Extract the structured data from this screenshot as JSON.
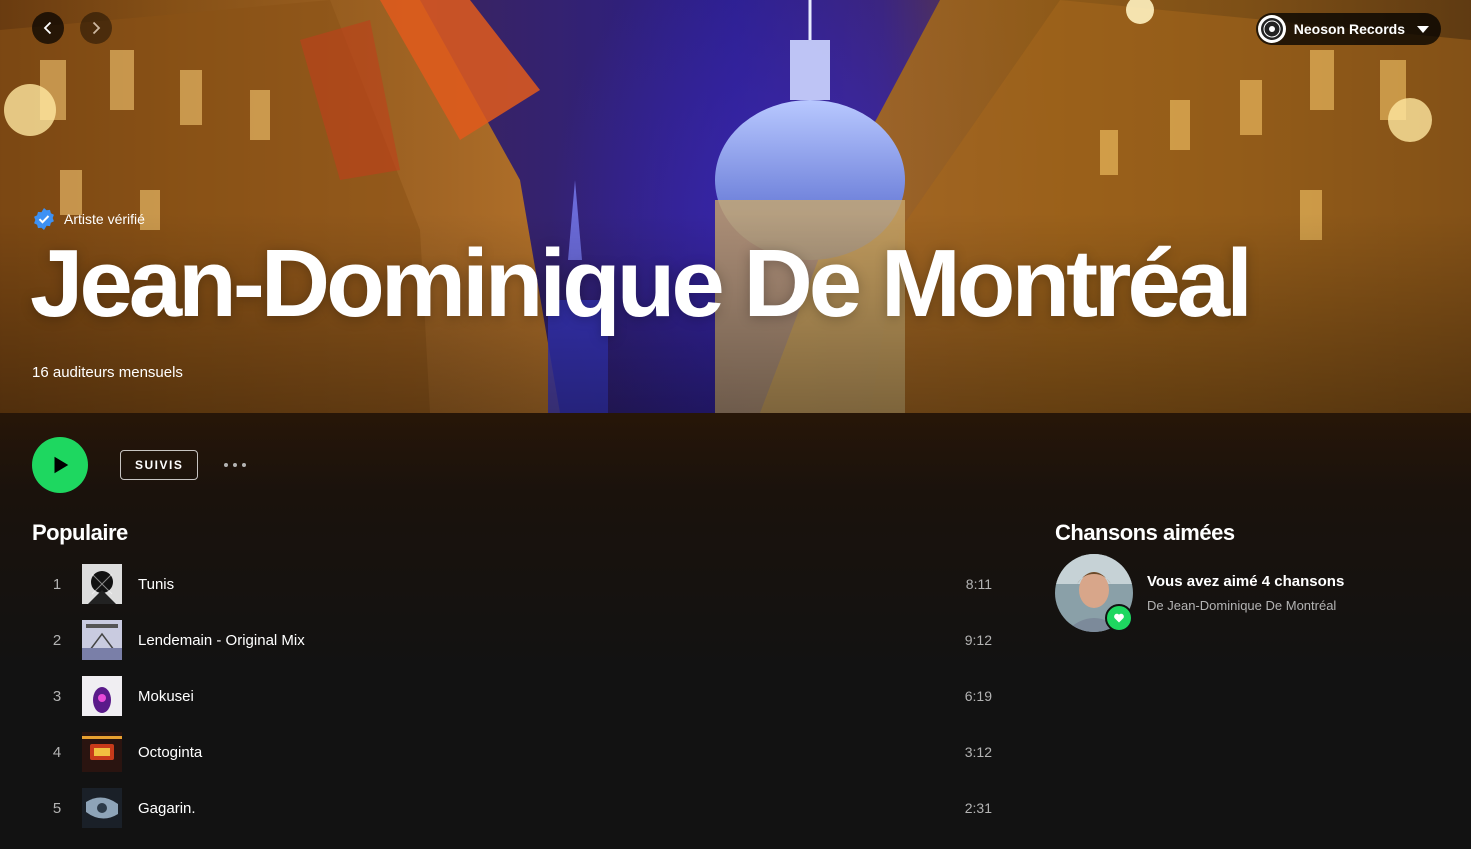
{
  "nav": {
    "back_icon": "chevron-left-icon",
    "forward_icon": "chevron-right-icon"
  },
  "user": {
    "name": "Neoson Records"
  },
  "artist": {
    "verified_label": "Artiste vérifié",
    "name": "Jean-Dominique De Montréal",
    "monthly_listeners": "16 auditeurs mensuels"
  },
  "actions": {
    "follow_label": "SUIVIS"
  },
  "popular": {
    "title": "Populaire",
    "tracks": [
      {
        "num": "1",
        "title": "Tunis",
        "duration": "8:11"
      },
      {
        "num": "2",
        "title": "Lendemain - Original Mix",
        "duration": "9:12"
      },
      {
        "num": "3",
        "title": "Mokusei",
        "duration": "6:19"
      },
      {
        "num": "4",
        "title": "Octoginta",
        "duration": "3:12"
      },
      {
        "num": "5",
        "title": "Gagarin.",
        "duration": "2:31"
      }
    ]
  },
  "liked": {
    "title": "Chansons aimées",
    "count_text": "Vous avez aimé 4 chansons",
    "by_text": "De Jean-Dominique De Montréal"
  },
  "colors": {
    "accent": "#1ed760",
    "background": "#121212",
    "verified_blue": "#3d91f4"
  }
}
